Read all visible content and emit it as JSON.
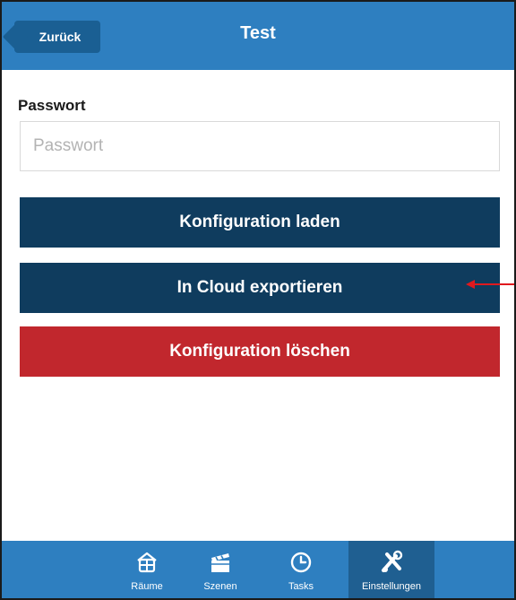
{
  "header": {
    "back_label": "Zurück",
    "title": "Test"
  },
  "password": {
    "label": "Passwort",
    "placeholder": "Passwort",
    "value": ""
  },
  "actions": {
    "load_label": "Konfiguration laden",
    "export_label": "In Cloud exportieren",
    "delete_label": "Konfiguration löschen"
  },
  "tabbar": {
    "items": [
      {
        "label": "Räume",
        "icon": "rooms-icon"
      },
      {
        "label": "Szenen",
        "icon": "clapperboard-icon"
      },
      {
        "label": "Tasks",
        "icon": "clock-icon"
      },
      {
        "label": "Einstellungen",
        "icon": "tools-icon",
        "active": true
      }
    ]
  },
  "colors": {
    "header_bg": "#2e7fc0",
    "back_button_bg": "#1a5f93",
    "primary_button": "#0f3c5e",
    "danger_button": "#c1272d",
    "annotation_arrow": "#e0191e"
  }
}
